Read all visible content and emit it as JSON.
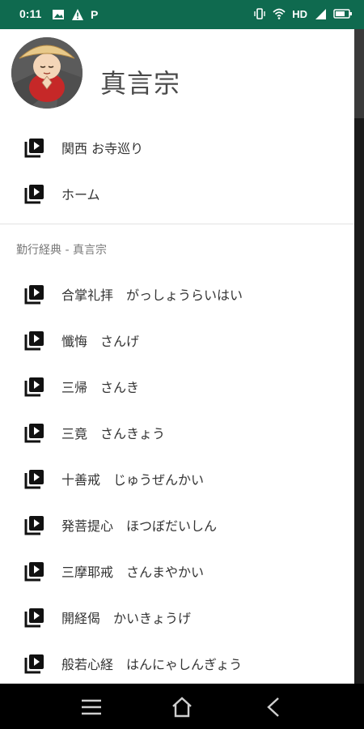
{
  "status_bar": {
    "time": "0:11",
    "network_label": "HD",
    "icons": [
      "image-icon",
      "warning-icon",
      "p-icon",
      "vibrate-icon",
      "wifi-icon",
      "signal-icon",
      "battery-icon"
    ],
    "p_letter": "P"
  },
  "drawer": {
    "header_title": "真言宗",
    "top_items": [
      {
        "label": "関西 お寺巡り",
        "icon": "playlist-play-icon"
      },
      {
        "label": "ホーム",
        "icon": "playlist-play-icon"
      }
    ],
    "section_title": "勤行経典 - 真言宗",
    "section_items": [
      {
        "label": "合掌礼拝　がっしょうらいはい",
        "icon": "playlist-play-icon"
      },
      {
        "label": "懺悔　さんげ",
        "icon": "playlist-play-icon"
      },
      {
        "label": "三帰　さんき",
        "icon": "playlist-play-icon"
      },
      {
        "label": "三竟　さんきょう",
        "icon": "playlist-play-icon"
      },
      {
        "label": "十善戒　じゅうぜんかい",
        "icon": "playlist-play-icon"
      },
      {
        "label": "発菩提心　ほつぼだいしん",
        "icon": "playlist-play-icon"
      },
      {
        "label": "三摩耶戒　さんまやかい",
        "icon": "playlist-play-icon"
      },
      {
        "label": "開経偈　かいきょうげ",
        "icon": "playlist-play-icon"
      },
      {
        "label": "般若心経　はんにゃしんぎょう",
        "icon": "playlist-play-icon"
      }
    ]
  },
  "nav_bar": {
    "buttons": [
      "menu-icon",
      "home-icon",
      "back-icon"
    ]
  },
  "colors": {
    "status_bar": "#0f6a4f",
    "drawer_bg": "#ffffff",
    "text": "#333333",
    "section_text": "#7a7a7a",
    "nav_bar": "#000000"
  }
}
